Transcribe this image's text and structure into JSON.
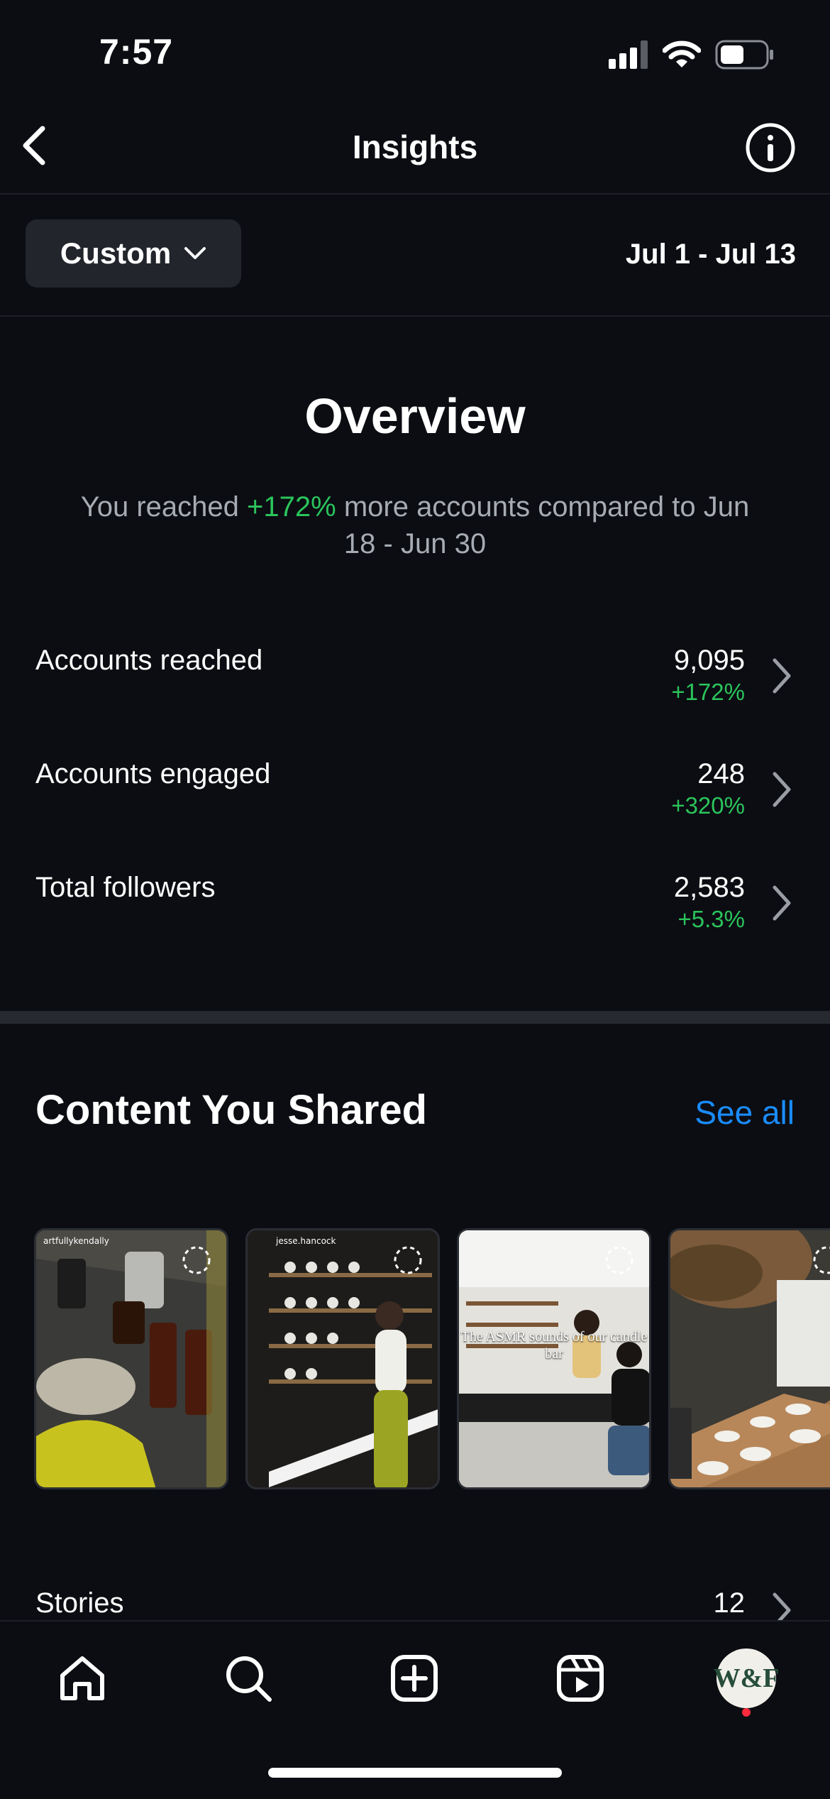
{
  "status_bar": {
    "time": "7:57",
    "icons": [
      "signal-icon",
      "wifi-icon",
      "battery-icon"
    ]
  },
  "header": {
    "title": "Insights",
    "back_icon": "chevron-left-icon",
    "info_icon": "info-icon"
  },
  "filter": {
    "range_button": "Custom",
    "date_range": "Jul 1 - Jul 13"
  },
  "overview": {
    "title": "Overview",
    "summary_prefix": "You reached ",
    "summary_highlight": "+172%",
    "summary_suffix": " more accounts compared to Jun 18 - Jun 30",
    "metrics": [
      {
        "label": "Accounts reached",
        "value": "9,095",
        "change": "+172%"
      },
      {
        "label": "Accounts engaged",
        "value": "248",
        "change": "+320%"
      },
      {
        "label": "Total followers",
        "value": "2,583",
        "change": "+5.3%"
      }
    ]
  },
  "content_shared": {
    "title": "Content You Shared",
    "see_all": "See all",
    "thumbnails": [
      {
        "user": "artfullykendally",
        "overlay": ""
      },
      {
        "user": "jesse.hancock",
        "overlay": ""
      },
      {
        "user": "",
        "overlay": "The ASMR sounds of our candle bar"
      },
      {
        "user": "",
        "overlay": ""
      }
    ],
    "stories": {
      "label": "Stories",
      "count": "12"
    }
  },
  "tabbar": {
    "tabs": [
      "home-icon",
      "search-icon",
      "create-icon",
      "reels-icon",
      "profile-avatar"
    ],
    "avatar_text": "W&F"
  },
  "colors": {
    "accent_green": "#2bc45c",
    "link_blue": "#1a8cff",
    "background": "#0b0d12"
  }
}
